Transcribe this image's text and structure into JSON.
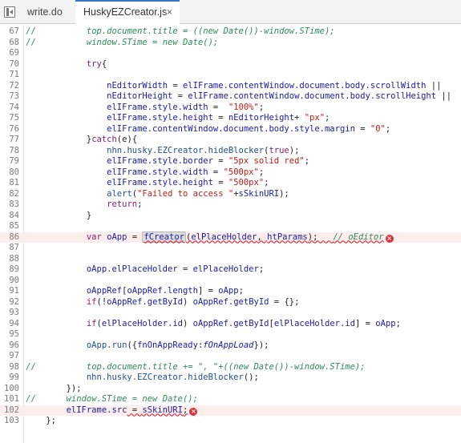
{
  "tabs": [
    {
      "label": "write.do",
      "active": false
    },
    {
      "label": "HuskyEZCreator.js",
      "active": true,
      "close_glyph": "×"
    }
  ],
  "editor": {
    "lines": [
      {
        "n": "67",
        "hl": false,
        "segs": [
          [
            "cm",
            "//"
          ],
          [
            "cm it",
            "          top.document.title = ((new Date())-window.STime);"
          ]
        ]
      },
      {
        "n": "68",
        "hl": false,
        "segs": [
          [
            "cm",
            "//"
          ],
          [
            "cm it",
            "          window.STime = new Date();"
          ]
        ]
      },
      {
        "n": "69",
        "hl": false,
        "segs": []
      },
      {
        "n": "70",
        "hl": false,
        "segs": [
          [
            "pl",
            "            "
          ],
          [
            "kw",
            "try"
          ],
          [
            "pl",
            "{"
          ]
        ]
      },
      {
        "n": "71",
        "hl": false,
        "segs": []
      },
      {
        "n": "72",
        "hl": false,
        "segs": [
          [
            "pl",
            "                "
          ],
          [
            "id",
            "nEditorWidth"
          ],
          [
            "pl",
            " = "
          ],
          [
            "id",
            "elIFrame.contentWindow.document.body.scrollWidth"
          ],
          [
            "pl",
            " ||"
          ]
        ]
      },
      {
        "n": "73",
        "hl": false,
        "segs": [
          [
            "pl",
            "                "
          ],
          [
            "id",
            "nEditorHeight"
          ],
          [
            "pl",
            " = "
          ],
          [
            "id",
            "elIFrame.contentWindow.document.body.scrollHeight"
          ],
          [
            "pl",
            " ||"
          ]
        ]
      },
      {
        "n": "74",
        "hl": false,
        "segs": [
          [
            "pl",
            "                "
          ],
          [
            "id",
            "elIFrame.style.width"
          ],
          [
            "pl",
            " =  "
          ],
          [
            "st",
            "\"100%\""
          ],
          [
            "pl",
            ";"
          ]
        ]
      },
      {
        "n": "75",
        "hl": false,
        "segs": [
          [
            "pl",
            "                "
          ],
          [
            "id",
            "elIFrame.style.height"
          ],
          [
            "pl",
            " = "
          ],
          [
            "id",
            "nEditorHeight"
          ],
          [
            "pl",
            "+ "
          ],
          [
            "st",
            "\"px\""
          ],
          [
            "pl",
            ";"
          ]
        ]
      },
      {
        "n": "76",
        "hl": false,
        "segs": [
          [
            "pl",
            "                "
          ],
          [
            "id",
            "elIFrame.contentWindow.document.body.style.margin"
          ],
          [
            "pl",
            " = "
          ],
          [
            "st",
            "\"0\""
          ],
          [
            "pl",
            ";"
          ]
        ]
      },
      {
        "n": "77",
        "hl": false,
        "segs": [
          [
            "pl",
            "            }"
          ],
          [
            "kw",
            "catch"
          ],
          [
            "pl",
            "(e){"
          ]
        ]
      },
      {
        "n": "78",
        "hl": false,
        "segs": [
          [
            "pl",
            "                "
          ],
          [
            "fn",
            "nhn.husky.EZCreator.hideBlocker"
          ],
          [
            "pl",
            "("
          ],
          [
            "kw",
            "true"
          ],
          [
            "pl",
            ");"
          ]
        ]
      },
      {
        "n": "79",
        "hl": false,
        "segs": [
          [
            "pl",
            "                "
          ],
          [
            "id",
            "elIFrame.style.border"
          ],
          [
            "pl",
            " = "
          ],
          [
            "st",
            "\"5px solid red\""
          ],
          [
            "pl",
            ";"
          ]
        ]
      },
      {
        "n": "80",
        "hl": false,
        "segs": [
          [
            "pl",
            "                "
          ],
          [
            "id",
            "elIFrame.style.width"
          ],
          [
            "pl",
            " = "
          ],
          [
            "st",
            "\"500px\""
          ],
          [
            "pl",
            ";"
          ]
        ]
      },
      {
        "n": "81",
        "hl": false,
        "segs": [
          [
            "pl",
            "                "
          ],
          [
            "id",
            "elIFrame.style.height"
          ],
          [
            "pl",
            " = "
          ],
          [
            "st",
            "\"500px\""
          ],
          [
            "pl",
            ";"
          ]
        ]
      },
      {
        "n": "82",
        "hl": false,
        "segs": [
          [
            "pl",
            "                "
          ],
          [
            "fn",
            "alert"
          ],
          [
            "pl",
            "("
          ],
          [
            "st",
            "\"Failed to access \""
          ],
          [
            "pl",
            "+"
          ],
          [
            "id",
            "sSkinURI"
          ],
          [
            "pl",
            ");"
          ]
        ]
      },
      {
        "n": "83",
        "hl": false,
        "segs": [
          [
            "pl",
            "                "
          ],
          [
            "kw",
            "return"
          ],
          [
            "pl",
            ";"
          ]
        ]
      },
      {
        "n": "84",
        "hl": false,
        "segs": [
          [
            "pl",
            "            }"
          ]
        ]
      },
      {
        "n": "85",
        "hl": false,
        "segs": []
      },
      {
        "n": "86",
        "hl": true,
        "segs": [
          [
            "pl",
            "            "
          ],
          [
            "kw",
            "var"
          ],
          [
            "pl",
            " "
          ],
          [
            "id",
            "oApp"
          ],
          [
            "pl",
            " = "
          ],
          [
            "id sq fc",
            "fCreator"
          ],
          [
            "pl sq",
            "("
          ],
          [
            "id sq",
            "elPlaceHolder"
          ],
          [
            "pl sq",
            ", "
          ],
          [
            "id sq",
            "htParams"
          ],
          [
            "pl sq",
            ");   "
          ],
          [
            "cm it sq",
            "// oEditor"
          ],
          [
            "err",
            "×"
          ]
        ]
      },
      {
        "n": "87",
        "hl": false,
        "segs": []
      },
      {
        "n": "88",
        "hl": false,
        "segs": []
      },
      {
        "n": "89",
        "hl": false,
        "segs": [
          [
            "pl",
            "            "
          ],
          [
            "id",
            "oApp.elPlaceHolder"
          ],
          [
            "pl",
            " = "
          ],
          [
            "id",
            "elPlaceHolder"
          ],
          [
            "pl",
            ";"
          ]
        ]
      },
      {
        "n": "90",
        "hl": false,
        "segs": []
      },
      {
        "n": "91",
        "hl": false,
        "segs": [
          [
            "pl",
            "            "
          ],
          [
            "id",
            "oAppRef"
          ],
          [
            "pl",
            "["
          ],
          [
            "id",
            "oAppRef.length"
          ],
          [
            "pl",
            "] = "
          ],
          [
            "id",
            "oApp"
          ],
          [
            "pl",
            ";"
          ]
        ]
      },
      {
        "n": "92",
        "hl": false,
        "segs": [
          [
            "pl",
            "            "
          ],
          [
            "kw",
            "if"
          ],
          [
            "pl",
            "(!"
          ],
          [
            "id",
            "oAppRef.getById"
          ],
          [
            "pl",
            ") "
          ],
          [
            "id",
            "oAppRef.getById"
          ],
          [
            "pl",
            " = {};"
          ]
        ]
      },
      {
        "n": "93",
        "hl": false,
        "segs": []
      },
      {
        "n": "94",
        "hl": false,
        "segs": [
          [
            "pl",
            "            "
          ],
          [
            "kw",
            "if"
          ],
          [
            "pl",
            "("
          ],
          [
            "id",
            "elPlaceHolder.id"
          ],
          [
            "pl",
            ") "
          ],
          [
            "id",
            "oAppRef.getById"
          ],
          [
            "pl",
            "["
          ],
          [
            "id",
            "elPlaceHolder.id"
          ],
          [
            "pl",
            "] = "
          ],
          [
            "id",
            "oApp"
          ],
          [
            "pl",
            ";"
          ]
        ]
      },
      {
        "n": "95",
        "hl": false,
        "segs": []
      },
      {
        "n": "96",
        "hl": false,
        "segs": [
          [
            "pl",
            "            "
          ],
          [
            "fn",
            "oApp.run"
          ],
          [
            "pl",
            "({"
          ],
          [
            "id",
            "fnOnAppReady"
          ],
          [
            "pl",
            ":"
          ],
          [
            "id it",
            "fOnAppLoad"
          ],
          [
            "pl",
            "});"
          ]
        ]
      },
      {
        "n": "97",
        "hl": false,
        "segs": []
      },
      {
        "n": "98",
        "hl": false,
        "segs": [
          [
            "cm",
            "//"
          ],
          [
            "cm it",
            "          top.document.title += \", \"+((new Date())-window.STime);"
          ]
        ]
      },
      {
        "n": "99",
        "hl": false,
        "segs": [
          [
            "pl",
            "            "
          ],
          [
            "fn",
            "nhn.husky.EZCreator.hideBlocker"
          ],
          [
            "pl",
            "();"
          ]
        ]
      },
      {
        "n": "100",
        "hl": false,
        "segs": [
          [
            "pl",
            "        });"
          ]
        ]
      },
      {
        "n": "101",
        "hl": false,
        "segs": [
          [
            "cm",
            "//"
          ],
          [
            "cm it",
            "      window.STime = new Date();"
          ]
        ]
      },
      {
        "n": "102",
        "hl": true,
        "segs": [
          [
            "pl",
            "        "
          ],
          [
            "id",
            "elIFrame.src"
          ],
          [
            "pl sq",
            " = "
          ],
          [
            "id sq",
            "sSkinURI"
          ],
          [
            "pl sq",
            ";"
          ],
          [
            "err",
            "×"
          ]
        ]
      },
      {
        "n": "103",
        "hl": false,
        "segs": [
          [
            "pl",
            "    };"
          ]
        ]
      }
    ]
  }
}
